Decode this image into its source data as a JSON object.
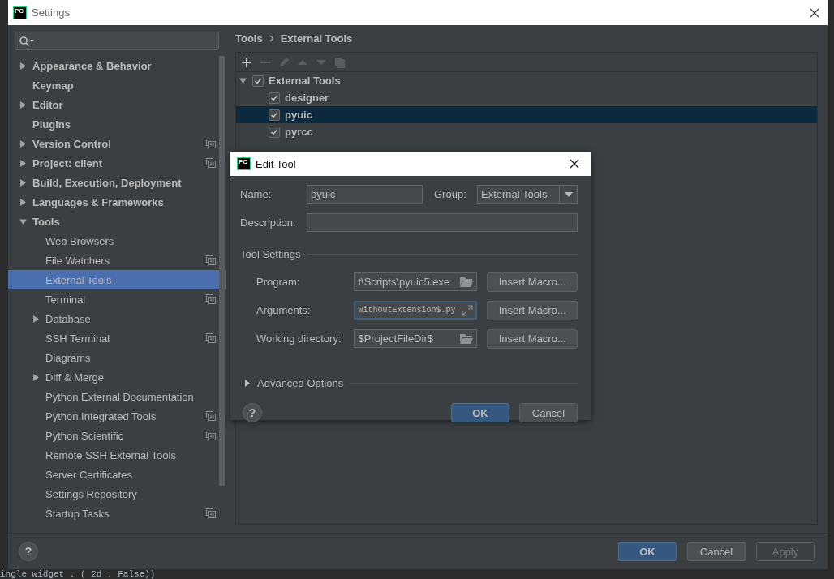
{
  "window": {
    "logo": "PC",
    "title": "Settings"
  },
  "sidebar": {
    "items": [
      {
        "label": "Appearance & Behavior",
        "kind": "group",
        "expanded": false,
        "selected": false,
        "project_level": false
      },
      {
        "label": "Keymap",
        "kind": "page",
        "selected": false,
        "project_level": false
      },
      {
        "label": "Editor",
        "kind": "group",
        "expanded": false,
        "selected": false,
        "project_level": false
      },
      {
        "label": "Plugins",
        "kind": "page",
        "selected": false,
        "project_level": false
      },
      {
        "label": "Version Control",
        "kind": "group",
        "expanded": false,
        "selected": false,
        "project_level": true
      },
      {
        "label": "Project: client",
        "kind": "group",
        "expanded": false,
        "selected": false,
        "project_level": true
      },
      {
        "label": "Build, Execution, Deployment",
        "kind": "group",
        "expanded": false,
        "selected": false,
        "project_level": false
      },
      {
        "label": "Languages & Frameworks",
        "kind": "group",
        "expanded": false,
        "selected": false,
        "project_level": false
      },
      {
        "label": "Tools",
        "kind": "group",
        "expanded": true,
        "selected": false,
        "project_level": false,
        "children": [
          {
            "label": "Web Browsers",
            "kind": "page",
            "selected": false,
            "project_level": false
          },
          {
            "label": "File Watchers",
            "kind": "page",
            "selected": false,
            "project_level": true
          },
          {
            "label": "External Tools",
            "kind": "page",
            "selected": true,
            "project_level": false
          },
          {
            "label": "Terminal",
            "kind": "page",
            "selected": false,
            "project_level": true
          },
          {
            "label": "Database",
            "kind": "group",
            "expanded": false,
            "selected": false,
            "project_level": false
          },
          {
            "label": "SSH Terminal",
            "kind": "page",
            "selected": false,
            "project_level": true
          },
          {
            "label": "Diagrams",
            "kind": "page",
            "selected": false,
            "project_level": false
          },
          {
            "label": "Diff & Merge",
            "kind": "group",
            "expanded": false,
            "selected": false,
            "project_level": false
          },
          {
            "label": "Python External Documentation",
            "kind": "page",
            "selected": false,
            "project_level": false
          },
          {
            "label": "Python Integrated Tools",
            "kind": "page",
            "selected": false,
            "project_level": true
          },
          {
            "label": "Python Scientific",
            "kind": "page",
            "selected": false,
            "project_level": true
          },
          {
            "label": "Remote SSH External Tools",
            "kind": "page",
            "selected": false,
            "project_level": false
          },
          {
            "label": "Server Certificates",
            "kind": "page",
            "selected": false,
            "project_level": false
          },
          {
            "label": "Settings Repository",
            "kind": "page",
            "selected": false,
            "project_level": false
          },
          {
            "label": "Startup Tasks",
            "kind": "page",
            "selected": false,
            "project_level": true
          }
        ]
      }
    ]
  },
  "breadcrumb": [
    "Tools",
    "External Tools"
  ],
  "tools_panel": {
    "toolbar": [
      {
        "kind": "add",
        "disabled": false
      },
      {
        "kind": "remove",
        "disabled": true
      },
      {
        "kind": "edit",
        "disabled": true
      },
      {
        "kind": "up",
        "disabled": true
      },
      {
        "kind": "down",
        "disabled": true
      },
      {
        "kind": "copy",
        "disabled": true
      }
    ],
    "tree": [
      {
        "label": "External Tools",
        "checked": true,
        "expanded": true,
        "selected": false,
        "children": [
          {
            "label": "designer",
            "checked": true,
            "selected": false
          },
          {
            "label": "pyuic",
            "checked": true,
            "selected": true
          },
          {
            "label": "pyrcc",
            "checked": true,
            "selected": false
          }
        ]
      }
    ]
  },
  "dialog": {
    "logo": "PC",
    "title": "Edit Tool",
    "name": {
      "label": "Name:",
      "value": "pyuic"
    },
    "group": {
      "label": "Group:",
      "value": "External Tools"
    },
    "description": {
      "label": "Description:"
    },
    "section": "Tool Settings",
    "settings": [
      {
        "label": "Program:",
        "value": "t\\Scripts\\pyuic5.exe",
        "kind": "browse",
        "focused": false,
        "button": "Insert Macro..."
      },
      {
        "label": "Arguments:",
        "value": "WithoutExtension$.py",
        "kind": "expand",
        "focused": true,
        "button": "Insert Macro..."
      },
      {
        "label": "Working directory:",
        "value": "$ProjectFileDir$",
        "kind": "browse",
        "focused": false,
        "button": "Insert Macro..."
      }
    ],
    "advanced": {
      "label": "Advanced Options",
      "expanded": false
    },
    "help": "?",
    "buttons": [
      {
        "label": "OK",
        "primary": true,
        "disabled": false
      },
      {
        "label": "Cancel",
        "primary": false,
        "disabled": false
      }
    ]
  },
  "footer": {
    "help": "?",
    "buttons": [
      {
        "label": "OK",
        "primary": true,
        "disabled": false
      },
      {
        "label": "Cancel",
        "primary": false,
        "disabled": false
      },
      {
        "label": "Apply",
        "primary": false,
        "disabled": true
      }
    ]
  },
  "background_code": "ingle widget . ( 2d . False))"
}
